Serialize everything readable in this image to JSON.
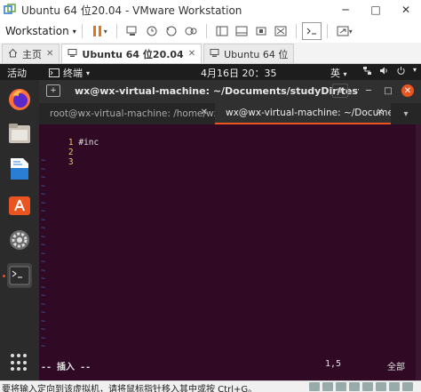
{
  "window": {
    "title": "Ubuntu 64 位20.04 - VMware Workstation",
    "minimize": "─",
    "maximize": "□",
    "close": "✕"
  },
  "toolbar": {
    "workstation_label": "Workstation",
    "caret": "▾"
  },
  "tabs": [
    {
      "label": "主页",
      "close": "✕"
    },
    {
      "label": "Ubuntu 64 位20.04",
      "close": "✕"
    },
    {
      "label": "Ubuntu 64 位",
      "close": ""
    }
  ],
  "topbar": {
    "activities": "活动",
    "app_menu": "终端",
    "app_menu_caret": "▾",
    "clock": "4月16日  20：35",
    "ime": "英",
    "ime_caret": "▾"
  },
  "terminal": {
    "title": "wx@wx-virtual-machine: ~/Documents/studyDir/test",
    "tabs": [
      {
        "label": "root@wx-virtual-machine: /home/wx...",
        "close": "✕"
      },
      {
        "label": "wx@wx-virtual-machine: ~/Documen...",
        "close": "✕"
      }
    ],
    "lines": [
      {
        "num": "1",
        "text": "#inc"
      },
      {
        "num": "2",
        "text": ""
      },
      {
        "num": "3",
        "text": ""
      }
    ],
    "tilde": "~",
    "status_mode": "-- 插入 --",
    "status_pos": "1,5",
    "status_all": "全部"
  },
  "statusbar": {
    "hint": "要将输入定向到该虚拟机，请将鼠标指针移入其中或按 Ctrl+G。"
  },
  "colors": {
    "terminal_bg": "#300a24",
    "accent": "#e95420",
    "line_number": "#e9c46a",
    "tilde": "#3465a4"
  }
}
